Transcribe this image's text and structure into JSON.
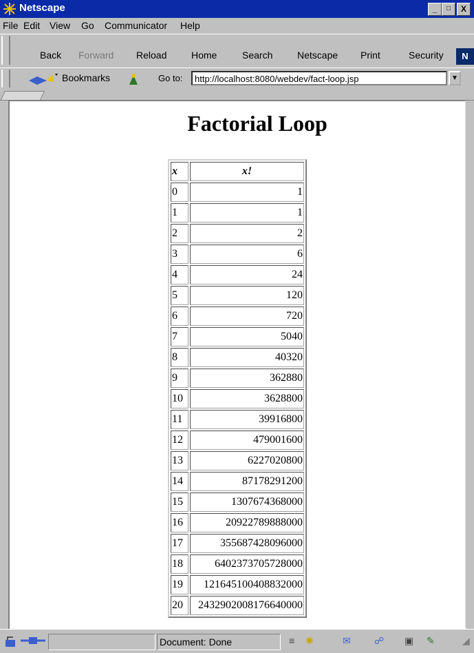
{
  "window": {
    "title": "Netscape",
    "min": "_",
    "max": "□",
    "close": "X"
  },
  "menu": {
    "file": "File",
    "edit": "Edit",
    "view": "View",
    "go": "Go",
    "communicator": "Communicator",
    "help": "Help"
  },
  "nav": {
    "back": "Back",
    "forward": "Forward",
    "reload": "Reload",
    "home": "Home",
    "search": "Search",
    "netscape": "Netscape",
    "print": "Print",
    "security": "Security",
    "logo": "N"
  },
  "location": {
    "bookmarks": "Bookmarks",
    "goto": "Go to:",
    "url": "http://localhost:8080/webdev/fact-loop.jsp"
  },
  "page": {
    "title": "Factorial Loop",
    "headers": {
      "x": "x",
      "fact": "x!"
    },
    "rows": [
      [
        "0",
        "1"
      ],
      [
        "1",
        "1"
      ],
      [
        "2",
        "2"
      ],
      [
        "3",
        "6"
      ],
      [
        "4",
        "24"
      ],
      [
        "5",
        "120"
      ],
      [
        "6",
        "720"
      ],
      [
        "7",
        "5040"
      ],
      [
        "8",
        "40320"
      ],
      [
        "9",
        "362880"
      ],
      [
        "10",
        "3628800"
      ],
      [
        "11",
        "39916800"
      ],
      [
        "12",
        "479001600"
      ],
      [
        "13",
        "6227020800"
      ],
      [
        "14",
        "87178291200"
      ],
      [
        "15",
        "1307674368000"
      ],
      [
        "16",
        "20922789888000"
      ],
      [
        "17",
        "355687428096000"
      ],
      [
        "18",
        "6402373705728000"
      ],
      [
        "19",
        "121645100408832000"
      ],
      [
        "20",
        "2432902008176640000"
      ]
    ]
  },
  "status": {
    "text": "Document: Done"
  }
}
